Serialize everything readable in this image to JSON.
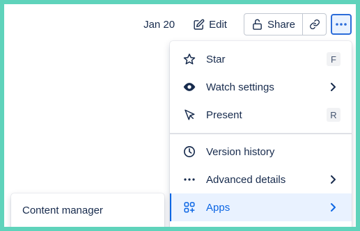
{
  "toolbar": {
    "date": "Jan 20",
    "edit_label": "Edit",
    "share_label": "Share",
    "icons": {
      "edit": "pencil-square-icon",
      "share": "unlock-icon",
      "link": "link-icon",
      "more": "more-horizontal-icon"
    }
  },
  "menu": {
    "items": [
      {
        "label": "Star",
        "icon": "star-icon",
        "shortcut": "F"
      },
      {
        "label": "Watch settings",
        "icon": "eye-icon",
        "submenu": true
      },
      {
        "label": "Present",
        "icon": "cursor-icon",
        "shortcut": "R"
      },
      {
        "label": "Version history",
        "icon": "clock-icon"
      },
      {
        "label": "Advanced details",
        "icon": "dots-icon",
        "submenu": true
      },
      {
        "label": "Apps",
        "icon": "apps-icon",
        "submenu": true,
        "active": true
      }
    ]
  },
  "panel": {
    "item": "Content manager"
  },
  "colors": {
    "frame": "#5fd3bb",
    "accent": "#0c66e4",
    "active_bg": "#e9f2ff"
  }
}
